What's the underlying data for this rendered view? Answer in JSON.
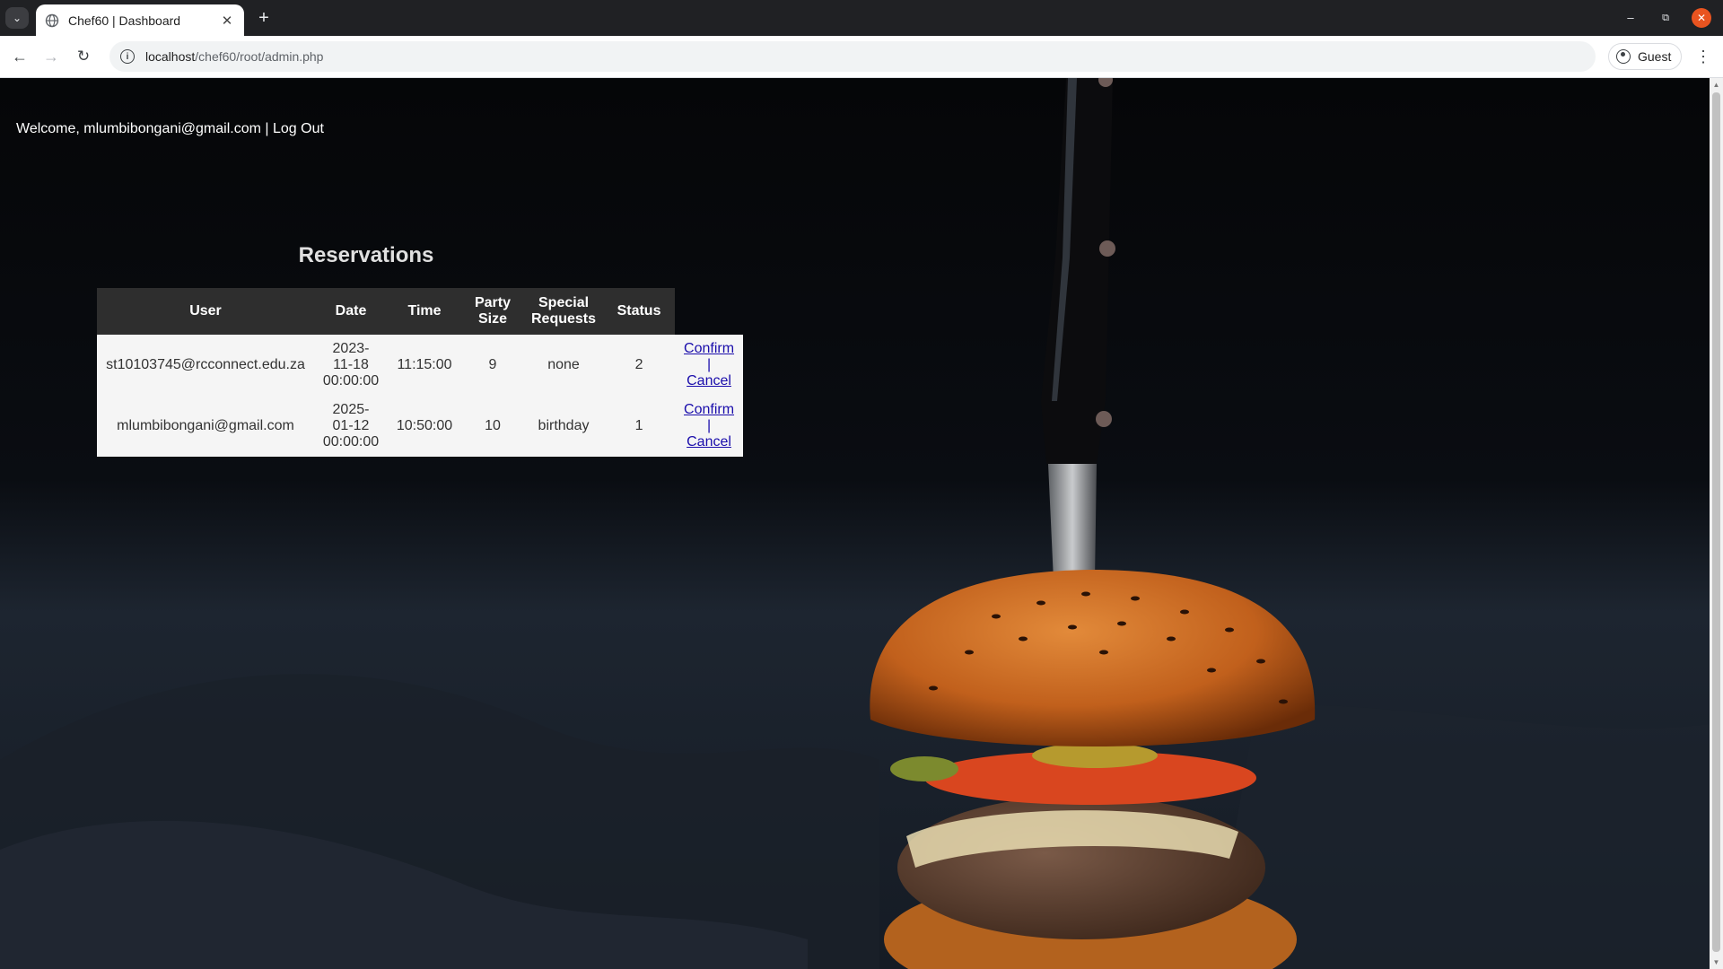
{
  "browser": {
    "tab_title": "Chef60 | Dashboard",
    "new_tab_label": "+",
    "url_host": "localhost",
    "url_path": "/chef60/root/admin.php",
    "profile_label": "Guest"
  },
  "page": {
    "welcome_prefix": "Welcome, ",
    "user_email": "mlumbibongani@gmail.com",
    "separator": " | ",
    "logout_label": "Log Out",
    "heading": "Reservations"
  },
  "table": {
    "headers": {
      "user": "User",
      "date": "Date",
      "time": "Time",
      "party_size_1": "Party",
      "party_size_2": "Size",
      "special_requests_1": "Special",
      "special_requests_2": "Requests",
      "status": "Status"
    },
    "rows": [
      {
        "user": "st10103745@rcconnect.edu.za",
        "date_1": "2023-",
        "date_2": "11-18",
        "date_3": "00:00:00",
        "time": "11:15:00",
        "party_size": "9",
        "special_requests": "none",
        "status": "2",
        "confirm_label": "Confirm",
        "pipe": "|",
        "cancel_label": "Cancel"
      },
      {
        "user": "mlumbibongani@gmail.com",
        "date_1": "2025-",
        "date_2": "01-12",
        "date_3": "00:00:00",
        "time": "10:50:00",
        "party_size": "10",
        "special_requests": "birthday",
        "status": "1",
        "confirm_label": "Confirm",
        "pipe": "|",
        "cancel_label": "Cancel"
      }
    ]
  },
  "colors": {
    "page_background": "#020202",
    "table_header_bg": "#2e2e2e",
    "table_row_bg": "#f5f5f5",
    "link": "#1a0dab",
    "window_close": "#e95420"
  }
}
